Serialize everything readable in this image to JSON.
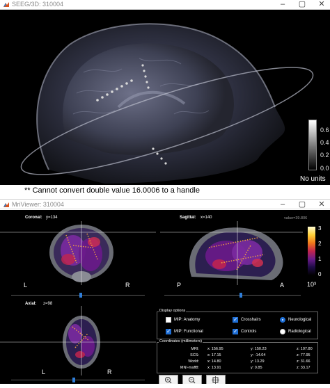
{
  "window1": {
    "title": "SEEG/3D: 310004",
    "colorbar_ticks": [
      "0.6",
      "0.4",
      "0.2",
      "0.0"
    ],
    "colorbar_units": "No units"
  },
  "console": {
    "message": "** Cannot convert double value 16.0006 to a handle"
  },
  "window2": {
    "title": "MriViewer: 310004",
    "coronal": {
      "label": "Coronal:",
      "coord": "y=134",
      "left": "L",
      "right": "R",
      "slider_level": 0.52
    },
    "sagittal": {
      "label": "Sagittal:",
      "coord": "x=140",
      "value": "value=39.806",
      "left": "P",
      "right": "A",
      "slider_level": 0.56
    },
    "axial": {
      "label": "Axial:",
      "coord": "z=98",
      "left": "L",
      "right": "R",
      "slider_level": 0.47
    },
    "colorbar_ticks": [
      "3",
      "2",
      "1",
      "0"
    ],
    "colorbar_exponent": "10³"
  },
  "display_options": {
    "title": "Display options",
    "mip_anatomy": {
      "label": "MIP: Anatomy",
      "checked": false
    },
    "mip_functional": {
      "label": "MIP: Functional",
      "checked": true
    },
    "crosshairs": {
      "label": "Crosshairs",
      "checked": true
    },
    "controls": {
      "label": "Controls",
      "checked": true
    },
    "neurological": {
      "label": "Neurological",
      "selected": true
    },
    "radiological": {
      "label": "Radiological",
      "selected": false
    }
  },
  "coordinates": {
    "title": "Coordinates (millimeters)",
    "rows": [
      {
        "label": "MRI:",
        "x": "x: 156.95",
        "y": "y: 150.23",
        "z": "z: 107.80"
      },
      {
        "label": "SCS:",
        "x": "x: 17.15",
        "y": "y: -14.04",
        "z": "z: 77.95"
      },
      {
        "label": "World:",
        "x": "x: 14.80",
        "y": "y: 13.29",
        "z": "z: 31.66"
      },
      {
        "label": "MNI-maff8:",
        "x": "x: 13.91",
        "y": "y: 0.85",
        "z": "z: 33.17"
      }
    ]
  },
  "icons": [
    "matlab-app-icon",
    "minimize-icon",
    "maximize-icon",
    "close-icon",
    "zoom-in-icon",
    "zoom-out-icon",
    "settings-icon"
  ]
}
